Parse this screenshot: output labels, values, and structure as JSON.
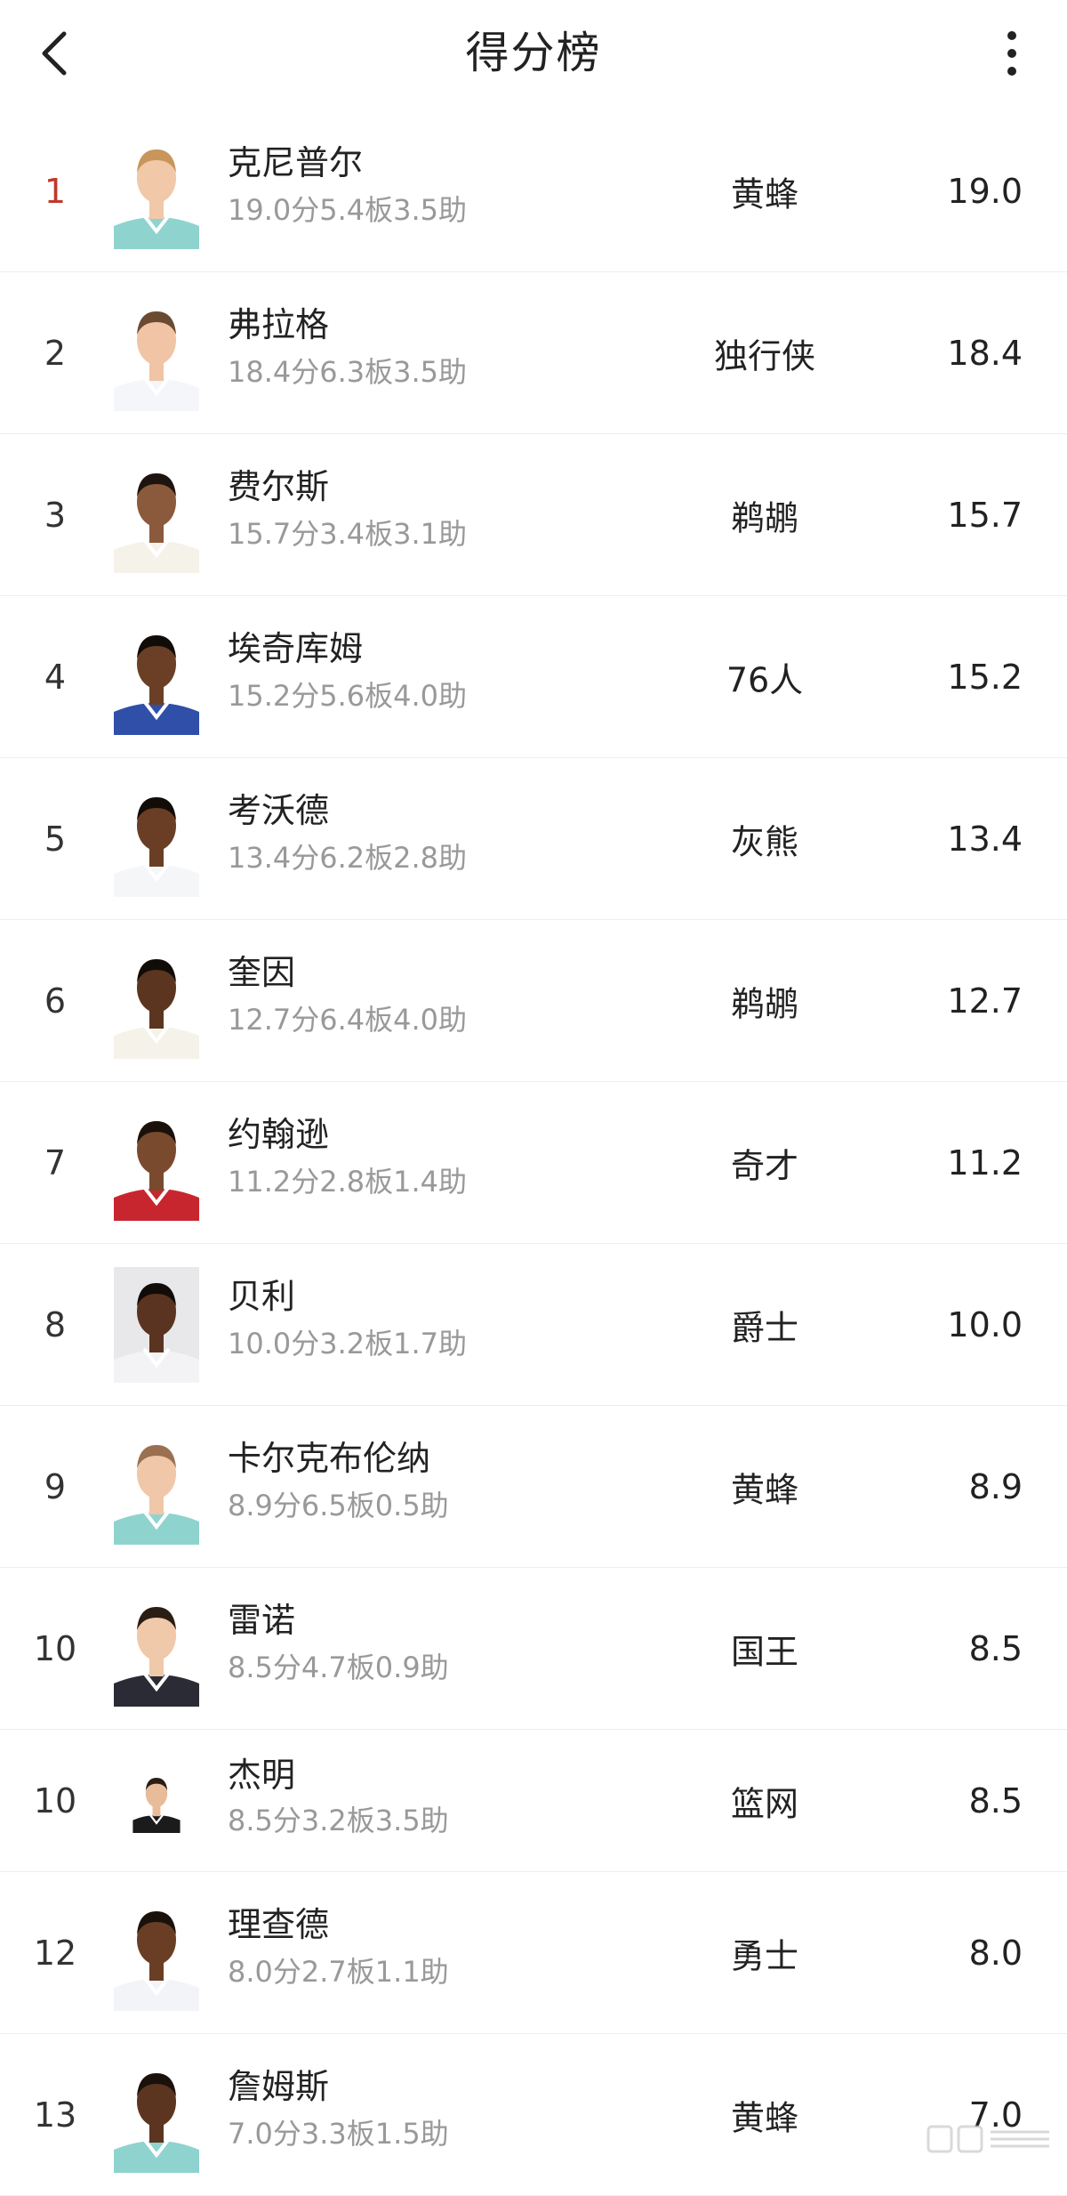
{
  "header": {
    "title": "得分榜"
  },
  "players": [
    {
      "rank": "1",
      "name": "克尼普尔",
      "stats": "19.0分5.4板3.5助",
      "team": "黄蜂",
      "score": "19.0",
      "jersey": "#8fd3cf",
      "skin": "#f1c8a8",
      "hair": "#c8955a"
    },
    {
      "rank": "2",
      "name": "弗拉格",
      "stats": "18.4分6.3板3.5助",
      "team": "独行侠",
      "score": "18.4",
      "jersey": "#f4f6fa",
      "skin": "#f0c4a4",
      "hair": "#6b4a32"
    },
    {
      "rank": "3",
      "name": "费尔斯",
      "stats": "15.7分3.4板3.1助",
      "team": "鹈鹕",
      "score": "15.7",
      "jersey": "#f5f2ea",
      "skin": "#8b5a3c",
      "hair": "#1d1410"
    },
    {
      "rank": "4",
      "name": "埃奇库姆",
      "stats": "15.2分5.6板4.0助",
      "team": "76人",
      "score": "15.2",
      "jersey": "#2f4fa8",
      "skin": "#6b3f26",
      "hair": "#120c08"
    },
    {
      "rank": "5",
      "name": "考沃德",
      "stats": "13.4分6.2板2.8助",
      "team": "灰熊",
      "score": "13.4",
      "jersey": "#f5f6f8",
      "skin": "#6a3e25",
      "hair": "#120c08"
    },
    {
      "rank": "6",
      "name": "奎因",
      "stats": "12.7分6.4板4.0助",
      "team": "鹈鹕",
      "score": "12.7",
      "jersey": "#f5f2ea",
      "skin": "#5c3520",
      "hair": "#120c08"
    },
    {
      "rank": "7",
      "name": "约翰逊",
      "stats": "11.2分2.8板1.4助",
      "team": "奇才",
      "score": "11.2",
      "jersey": "#c8262e",
      "skin": "#7a4a2e",
      "hair": "#1a110b"
    },
    {
      "rank": "8",
      "name": "贝利",
      "stats": "10.0分3.2板1.7助",
      "team": "爵士",
      "score": "10.0",
      "jersey": "#f3f3f6",
      "skin": "#5a3420",
      "hair": "#120c08"
    },
    {
      "rank": "9",
      "name": "卡尔克布伦纳",
      "stats": "8.9分6.5板0.5助",
      "team": "黄蜂",
      "score": "8.9",
      "jersey": "#8fd3cf",
      "skin": "#f0c7a8",
      "hair": "#9a7050"
    },
    {
      "rank": "10",
      "name": "雷诺",
      "stats": "8.5分4.7板0.9助",
      "team": "国王",
      "score": "8.5",
      "jersey": "#2b2b35",
      "skin": "#f0c8aa",
      "hair": "#2a1d14"
    },
    {
      "rank": "10",
      "name": "杰明",
      "stats": "8.5分3.2板3.5助",
      "team": "篮网",
      "score": "8.5",
      "jersey": "#1b1b1b",
      "skin": "#e8bc98",
      "hair": "#2a1d14"
    },
    {
      "rank": "12",
      "name": "理查德",
      "stats": "8.0分2.7板1.1助",
      "team": "勇士",
      "score": "8.0",
      "jersey": "#f3f4f8",
      "skin": "#6a3e25",
      "hair": "#1a110b"
    },
    {
      "rank": "13",
      "name": "詹姆斯",
      "stats": "7.0分3.3板1.5助",
      "team": "黄蜂",
      "score": "7.0",
      "jersey": "#8fd3cf",
      "skin": "#5c3520",
      "hair": "#1a110b"
    }
  ]
}
